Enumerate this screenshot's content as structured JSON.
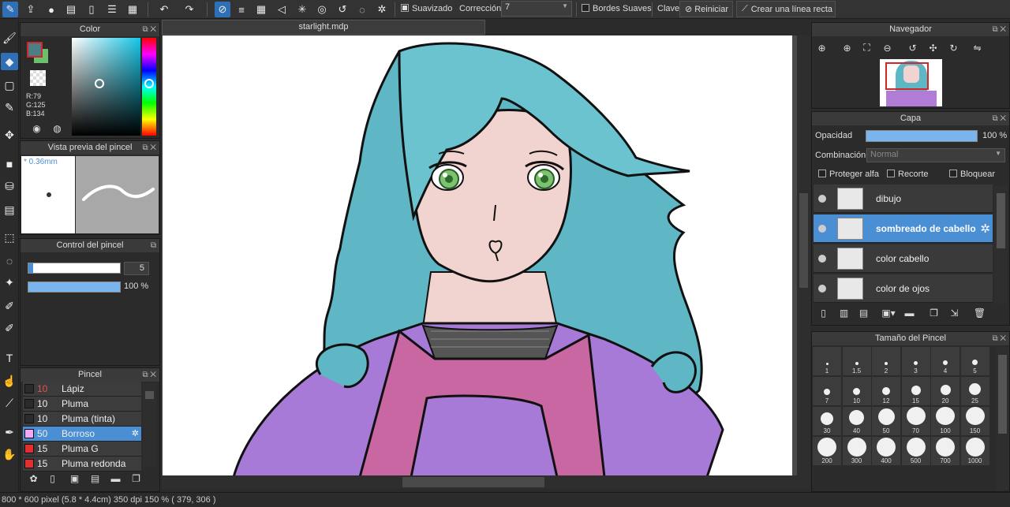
{
  "toolbar": {
    "suavizado_label": "Suavizado",
    "correccion_label": "Corrección",
    "correccion_value": "7",
    "bordes_label": "Bordes Suaves",
    "clave_label": "Clave",
    "reiniciar_label": "Reiniciar",
    "linea_label": "Crear una línea recta"
  },
  "color_panel": {
    "title": "Color",
    "r": "R:79",
    "g": "G:125",
    "b": "B:134",
    "fg_color": "#4f7d86",
    "bg_color": "#6cc06c"
  },
  "brush_preview": {
    "title": "Vista previa del pincel",
    "size_text": "* 0.36mm"
  },
  "brush_control": {
    "title": "Control del pincel",
    "size_value": "5",
    "opacity_value": "100 %"
  },
  "brush_panel": {
    "title": "Pincel",
    "items": [
      {
        "size": "10",
        "name": "Lápiz",
        "color": "#2b2b2b"
      },
      {
        "size": "10",
        "name": "Pluma",
        "color": "#2b2b2b"
      },
      {
        "size": "10",
        "name": "Pluma (tinta)",
        "color": "#2b2b2b"
      },
      {
        "size": "50",
        "name": "Borroso",
        "color": "#f4a8f4"
      },
      {
        "size": "15",
        "name": "Pluma G",
        "color": "#e23030"
      },
      {
        "size": "15",
        "name": "Pluma redonda",
        "color": "#e23030"
      }
    ]
  },
  "document": {
    "tab_title": "starlight.mdp"
  },
  "navigator": {
    "title": "Navegador"
  },
  "layer_panel": {
    "title": "Capa",
    "opacity_label": "Opacidad",
    "opacity_value": "100 %",
    "blend_label": "Combinación",
    "blend_value": "Normal",
    "protect_alpha": "Proteger alfa",
    "clip": "Recorte",
    "lock": "Bloquear",
    "layers": [
      {
        "name": "dibujo",
        "selected": false
      },
      {
        "name": "sombreado de cabello",
        "selected": true
      },
      {
        "name": "color cabello",
        "selected": false
      },
      {
        "name": "color de ojos",
        "selected": false
      }
    ]
  },
  "brush_size_panel": {
    "title": "Tamaño del Pincel",
    "sizes": [
      "1",
      "1.5",
      "2",
      "3",
      "4",
      "5",
      "7",
      "10",
      "12",
      "15",
      "20",
      "25",
      "30",
      "40",
      "50",
      "70",
      "100",
      "150",
      "200",
      "300",
      "400",
      "500",
      "700",
      "1000"
    ]
  },
  "status": {
    "text": "800 * 600 pixel  (5.8 * 4.4cm)  350 dpi  150 %  ( 379, 306 )"
  },
  "colors": {
    "accent": "#4a8fd4",
    "hair": "#5fb7c6",
    "shirt": "#a77ad8",
    "apron": "#c967a3",
    "skin": "#f1d3cf"
  }
}
